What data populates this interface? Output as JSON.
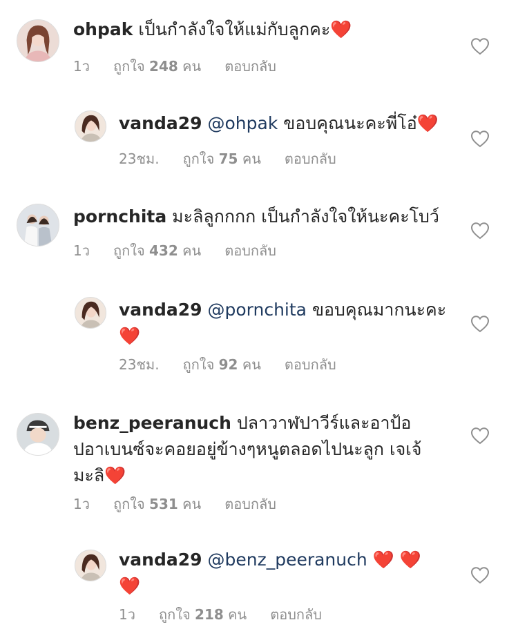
{
  "colors": {
    "text": "#262626",
    "meta": "#8e8e8e",
    "mention": "#1f3a5f",
    "heart": "#e0162b"
  },
  "icons": {
    "like": "heart-outline-icon",
    "emoji": "red-heart-emoji"
  },
  "comments": [
    {
      "username": "ohpak",
      "lines": [
        "เป็นกำลังใจให้แม่กับลูกคะ❤️"
      ],
      "time": "1ว",
      "likes_prefix": "ถูกใจ",
      "likes_count": "248",
      "likes_suffix": "คน",
      "reply": "ตอบกลับ"
    },
    {
      "username": "vanda29",
      "mention": "@ohpak",
      "lines": [
        "ขอบคุณนะคะพี่โอ๋❤️"
      ],
      "time": "23ชม.",
      "likes_prefix": "ถูกใจ",
      "likes_count": "75",
      "likes_suffix": "คน",
      "reply": "ตอบกลับ"
    },
    {
      "username": "pornchita",
      "lines": [
        "มะลิลูกกกก เป็นกำลังใจให้นะคะโบว์"
      ],
      "time": "1ว",
      "likes_prefix": "ถูกใจ",
      "likes_count": "432",
      "likes_suffix": "คน",
      "reply": "ตอบกลับ"
    },
    {
      "username": "vanda29",
      "mention": "@pornchita",
      "lines": [
        "ขอบคุณมากนะคะ",
        "❤️"
      ],
      "time": "23ชม.",
      "likes_prefix": "ถูกใจ",
      "likes_count": "92",
      "likes_suffix": "คน",
      "reply": "ตอบกลับ"
    },
    {
      "username": "benz_peeranuch",
      "lines": [
        "ปลาวาฬปาวีร์และอาป้อ",
        "ปอาเบนซ์จะคอยอยู่ข้างๆหนูตลอดไปนะลูก เจเจ้",
        "มะลิ❤️"
      ],
      "time": "1ว",
      "likes_prefix": "ถูกใจ",
      "likes_count": "531",
      "likes_suffix": "คน",
      "reply": "ตอบกลับ"
    },
    {
      "username": "vanda29",
      "mention": "@benz_peeranuch",
      "lines": [
        "❤️ ❤️",
        "❤️"
      ],
      "time": "1ว",
      "likes_prefix": "ถูกใจ",
      "likes_count": "218",
      "likes_suffix": "คน",
      "reply": "ตอบกลับ"
    }
  ]
}
